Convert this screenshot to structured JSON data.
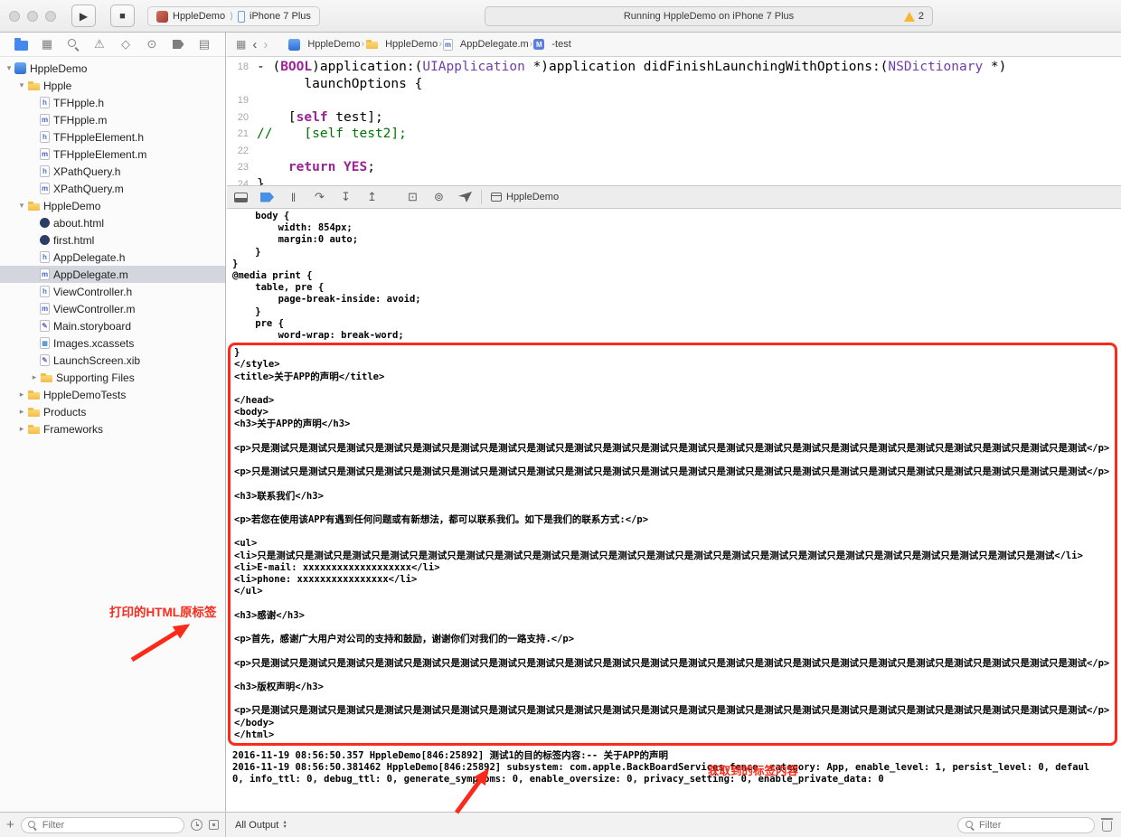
{
  "toolbar": {
    "status_text": "Running HppleDemo on iPhone 7 Plus",
    "warning_count": "2",
    "scheme_name": "HppleDemo",
    "device_name": "iPhone 7 Plus"
  },
  "navigator": {
    "tabs": [
      {
        "name": "project-navigator-icon",
        "glyph": ""
      },
      {
        "name": "symbol-navigator-icon",
        "glyph": "▦"
      },
      {
        "name": "find-navigator-icon",
        "glyph": ""
      },
      {
        "name": "issue-navigator-icon",
        "glyph": "⚠"
      },
      {
        "name": "test-navigator-icon",
        "glyph": "◇"
      },
      {
        "name": "debug-navigator-icon",
        "glyph": "⊙"
      },
      {
        "name": "breakpoint-navigator-icon",
        "glyph": ""
      },
      {
        "name": "report-navigator-icon",
        "glyph": "▤"
      }
    ],
    "selected_tab": 0,
    "items": [
      {
        "label": "HppleDemo",
        "level": 0,
        "icon": "project",
        "disclosure": "open"
      },
      {
        "label": "Hpple",
        "level": 1,
        "icon": "folder",
        "disclosure": "open"
      },
      {
        "label": "TFHpple.h",
        "level": 2,
        "icon": "h"
      },
      {
        "label": "TFHpple.m",
        "level": 2,
        "icon": "m"
      },
      {
        "label": "TFHppleElement.h",
        "level": 2,
        "icon": "h"
      },
      {
        "label": "TFHppleElement.m",
        "level": 2,
        "icon": "m"
      },
      {
        "label": "XPathQuery.h",
        "level": 2,
        "icon": "h"
      },
      {
        "label": "XPathQuery.m",
        "level": 2,
        "icon": "m"
      },
      {
        "label": "HppleDemo",
        "level": 1,
        "icon": "folder",
        "disclosure": "open"
      },
      {
        "label": "about.html",
        "level": 2,
        "icon": "html"
      },
      {
        "label": "first.html",
        "level": 2,
        "icon": "html"
      },
      {
        "label": "AppDelegate.h",
        "level": 2,
        "icon": "h"
      },
      {
        "label": "AppDelegate.m",
        "level": 2,
        "icon": "m",
        "selected": true
      },
      {
        "label": "ViewController.h",
        "level": 2,
        "icon": "h"
      },
      {
        "label": "ViewController.m",
        "level": 2,
        "icon": "m"
      },
      {
        "label": "Main.storyboard",
        "level": 2,
        "icon": "storyboard"
      },
      {
        "label": "Images.xcassets",
        "level": 2,
        "icon": "xcassets"
      },
      {
        "label": "LaunchScreen.xib",
        "level": 2,
        "icon": "xib"
      },
      {
        "label": "Supporting Files",
        "level": 2,
        "icon": "folder",
        "disclosure": "closed"
      },
      {
        "label": "HppleDemoTests",
        "level": 1,
        "icon": "folder",
        "disclosure": "closed"
      },
      {
        "label": "Products",
        "level": 1,
        "icon": "folder",
        "disclosure": "closed"
      },
      {
        "label": "Frameworks",
        "level": 1,
        "icon": "folder",
        "disclosure": "closed"
      }
    ],
    "filter_placeholder": "Filter"
  },
  "jump_bar": {
    "crumbs": [
      {
        "label": "HppleDemo",
        "icon": "project"
      },
      {
        "label": "HppleDemo",
        "icon": "folder"
      },
      {
        "label": "AppDelegate.m",
        "icon": "m"
      },
      {
        "label": "-test",
        "icon": "method"
      }
    ]
  },
  "editor": {
    "lines": [
      {
        "num": "18",
        "seg": [
          [
            "- ("
          ],
          [
            "BOOL",
            "kw"
          ],
          [
            ")application:("
          ],
          [
            "UIApplication",
            "type"
          ],
          [
            " *)application didFinishLaunchingWithOptions:("
          ],
          [
            "NSDictionary",
            "type"
          ],
          [
            " *)"
          ]
        ]
      },
      {
        "num": "",
        "seg": [
          [
            "      launchOptions {"
          ]
        ]
      },
      {
        "num": "19",
        "seg": []
      },
      {
        "num": "20",
        "seg": [
          [
            "    ["
          ],
          [
            "self",
            "kw"
          ],
          [
            " test];"
          ]
        ]
      },
      {
        "num": "21",
        "seg": [
          [
            "//    [self test2];",
            "comment"
          ]
        ]
      },
      {
        "num": "22",
        "seg": []
      },
      {
        "num": "23",
        "seg": [
          [
            "    "
          ],
          [
            "return",
            "kw"
          ],
          [
            " "
          ],
          [
            "YES",
            "kw"
          ],
          [
            ";"
          ]
        ]
      },
      {
        "num": "24",
        "seg": [
          [
            "}"
          ]
        ]
      }
    ]
  },
  "debug_bar": {
    "icons": [
      {
        "name": "hide-debug-area-icon",
        "glyph": ""
      },
      {
        "name": "breakpoints-toggle-icon",
        "glyph": ""
      },
      {
        "name": "pause-icon",
        "glyph": "‖"
      },
      {
        "name": "step-over-icon",
        "glyph": "↷"
      },
      {
        "name": "step-into-icon",
        "glyph": "↧"
      },
      {
        "name": "step-out-icon",
        "glyph": "↥"
      },
      {
        "name": "view-hierarchy-icon",
        "glyph": "⊡"
      },
      {
        "name": "memory-graph-icon",
        "glyph": "⊚"
      },
      {
        "name": "simulate-location-icon",
        "glyph": ""
      }
    ],
    "app_label": "HppleDemo"
  },
  "console": {
    "pre_lines": [
      "    body {",
      "        width: 854px;",
      "        margin:0 auto;",
      "    }",
      "}",
      "@media print {",
      "    table, pre {",
      "        page-break-inside: avoid;",
      "    }",
      "    pre {",
      "        word-wrap: break-word;"
    ],
    "boxed_lines": [
      "}",
      "</style>",
      "<title>关于APP的声明</title>",
      "",
      "</head>",
      "<body>",
      "<h3>关于APP的声明</h3>",
      "",
      "<p>只是测试只是测试只是测试只是测试只是测试只是测试只是测试只是测试只是测试只是测试只是测试只是测试只是测试只是测试只是测试只是测试只是测试只是测试只是测试只是测试只是测试只是测试</p>",
      "",
      "<p>只是测试只是测试只是测试只是测试只是测试只是测试只是测试只是测试只是测试只是测试只是测试只是测试只是测试只是测试只是测试只是测试只是测试只是测试只是测试只是测试只是测试只是测试</p>",
      "",
      "<h3>联系我们</h3>",
      "",
      "<p>若您在使用该APP有遇到任何问题或有新想法，都可以联系我们。如下是我们的联系方式:</p>",
      "",
      "<ul>",
      "<li>只是测试只是测试只是测试只是测试只是测试只是测试只是测试只是测试只是测试只是测试只是测试只是测试只是测试只是测试只是测试只是测试只是测试只是测试只是测试只是测试只是测试</li>",
      "<li>E-mail: xxxxxxxxxxxxxxxxxxx</li>",
      "<li>phone: xxxxxxxxxxxxxxxx</li>",
      "</ul>",
      "",
      "<h3>感谢</h3>",
      "",
      "<p>首先，感谢广大用户对公司的支持和鼓励，谢谢你们对我们的一路支持.</p>",
      "",
      "<p>只是测试只是测试只是测试只是测试只是测试只是测试只是测试只是测试只是测试只是测试只是测试只是测试只是测试只是测试只是测试只是测试只是测试只是测试只是测试只是测试只是测试只是测试</p>",
      "",
      "<h3>版权声明</h3>",
      "",
      "<p>只是测试只是测试只是测试只是测试只是测试只是测试只是测试只是测试只是测试只是测试只是测试只是测试只是测试只是测试只是测试只是测试只是测试只是测试只是测试只是测试只是测试只是测试</p>",
      "</body>",
      "</html>"
    ],
    "log_lines": [
      "2016-11-19 08:56:50.357 HppleDemo[846:25892] 测试1的目的标签内容:-- 关于APP的声明",
      "2016-11-19 08:56:50.381462 HppleDemo[846:25892] subsystem: com.apple.BackBoardServices.fence, category: App, enable_level: 1, persist_level: 0, defaul",
      "0, info_ttl: 0, debug_ttl: 0, generate_symptoms: 0, enable_oversize: 0, privacy_setting: 0, enable_private_data: 0"
    ]
  },
  "bottom_bar": {
    "all_output_label": "All Output",
    "left_filter_placeholder": "Filter",
    "right_filter_placeholder": "Filter"
  },
  "annotations": {
    "left_label": "打印的HTML原标签",
    "bottom_label": "获取到的标签内容",
    "red": "#fb2a1a"
  }
}
